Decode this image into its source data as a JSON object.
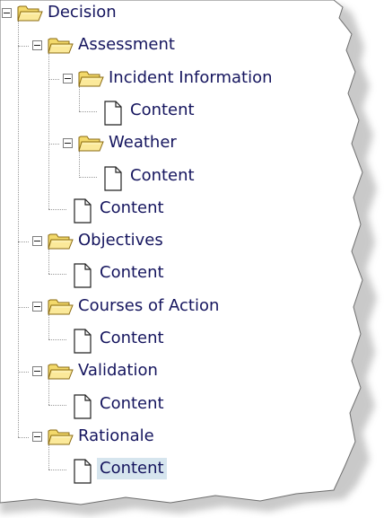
{
  "tree": {
    "nodes": [
      {
        "label": "Decision",
        "type": "folder",
        "expanded": true,
        "depth": 0
      },
      {
        "label": "Assessment",
        "type": "folder",
        "expanded": true,
        "depth": 1
      },
      {
        "label": "Incident Information",
        "type": "folder",
        "expanded": true,
        "depth": 2
      },
      {
        "label": "Content",
        "type": "document",
        "depth": 3
      },
      {
        "label": "Weather",
        "type": "folder",
        "expanded": true,
        "depth": 2
      },
      {
        "label": "Content",
        "type": "document",
        "depth": 3
      },
      {
        "label": "Content",
        "type": "document",
        "depth": 2
      },
      {
        "label": "Objectives",
        "type": "folder",
        "expanded": true,
        "depth": 1
      },
      {
        "label": "Content",
        "type": "document",
        "depth": 2
      },
      {
        "label": "Courses of Action",
        "type": "folder",
        "expanded": true,
        "depth": 1
      },
      {
        "label": "Content",
        "type": "document",
        "depth": 2
      },
      {
        "label": "Validation",
        "type": "folder",
        "expanded": true,
        "depth": 1
      },
      {
        "label": "Content",
        "type": "document",
        "depth": 2
      },
      {
        "label": "Rationale",
        "type": "folder",
        "expanded": true,
        "depth": 1
      },
      {
        "label": "Content",
        "type": "document",
        "depth": 2,
        "selected": true
      }
    ]
  },
  "colors": {
    "label_text": "#15155e",
    "selection_bg": "#d6e5ee",
    "folder_fill": "#f3d96b",
    "folder_edge": "#8a6a12",
    "tree_lines": "#9a9a9a"
  },
  "icons": {
    "folder": "open-folder-icon",
    "document": "document-icon",
    "toggle": "collapse-minus-icon"
  }
}
